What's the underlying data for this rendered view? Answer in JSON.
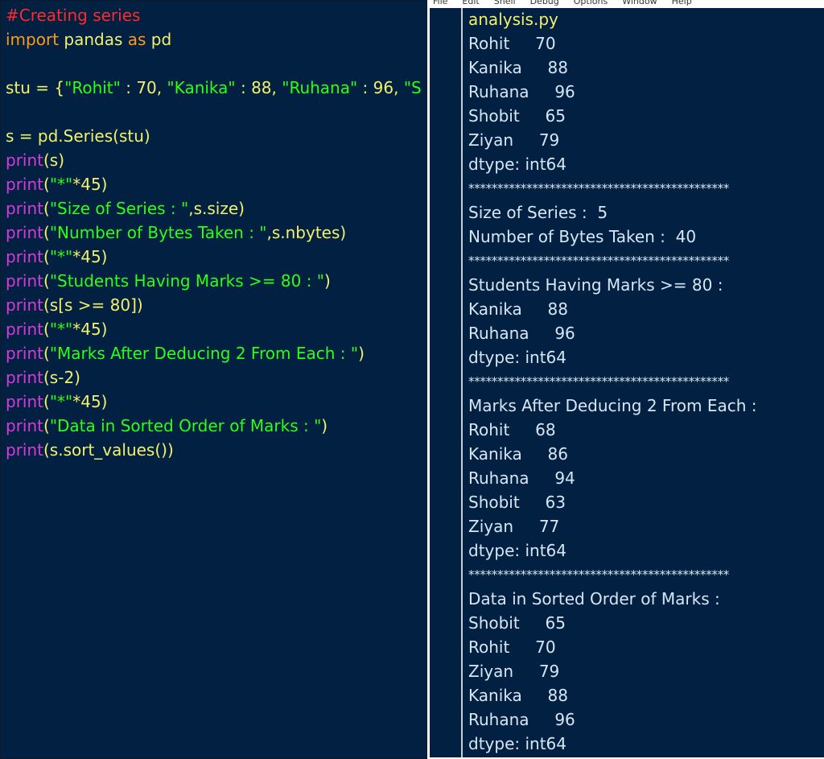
{
  "editor": {
    "lines": [
      {
        "tokens": [
          {
            "t": "comment",
            "v": "#Creating series"
          }
        ]
      },
      {
        "tokens": [
          {
            "t": "keyword",
            "v": "import"
          },
          {
            "t": "plain",
            "v": " pandas "
          },
          {
            "t": "keyword",
            "v": "as"
          },
          {
            "t": "plain",
            "v": " pd"
          }
        ]
      },
      {
        "tokens": []
      },
      {
        "tokens": [
          {
            "t": "plain",
            "v": "stu = {"
          },
          {
            "t": "string",
            "v": "\"Rohit\""
          },
          {
            "t": "plain",
            "v": " : 70, "
          },
          {
            "t": "string",
            "v": "\"Kanika\""
          },
          {
            "t": "plain",
            "v": " : 88, "
          },
          {
            "t": "string",
            "v": "\"Ruhana\""
          },
          {
            "t": "plain",
            "v": " : 96, "
          },
          {
            "t": "string",
            "v": "\"S"
          }
        ]
      },
      {
        "tokens": []
      },
      {
        "tokens": [
          {
            "t": "plain",
            "v": "s = pd.Series(stu)"
          }
        ]
      },
      {
        "tokens": [
          {
            "t": "builtin",
            "v": "print"
          },
          {
            "t": "plain",
            "v": "(s)"
          }
        ]
      },
      {
        "tokens": [
          {
            "t": "builtin",
            "v": "print"
          },
          {
            "t": "plain",
            "v": "("
          },
          {
            "t": "string",
            "v": "\"*\""
          },
          {
            "t": "plain",
            "v": "*45)"
          }
        ]
      },
      {
        "tokens": [
          {
            "t": "builtin",
            "v": "print"
          },
          {
            "t": "plain",
            "v": "("
          },
          {
            "t": "string",
            "v": "\"Size of Series : \""
          },
          {
            "t": "plain",
            "v": ",s.size)"
          }
        ]
      },
      {
        "tokens": [
          {
            "t": "builtin",
            "v": "print"
          },
          {
            "t": "plain",
            "v": "("
          },
          {
            "t": "string",
            "v": "\"Number of Bytes Taken : \""
          },
          {
            "t": "plain",
            "v": ",s.nbytes)"
          }
        ]
      },
      {
        "tokens": [
          {
            "t": "builtin",
            "v": "print"
          },
          {
            "t": "plain",
            "v": "("
          },
          {
            "t": "string",
            "v": "\"*\""
          },
          {
            "t": "plain",
            "v": "*45)"
          }
        ]
      },
      {
        "tokens": [
          {
            "t": "builtin",
            "v": "print"
          },
          {
            "t": "plain",
            "v": "("
          },
          {
            "t": "string",
            "v": "\"Students Having Marks >= 80 : \""
          },
          {
            "t": "plain",
            "v": ")"
          }
        ]
      },
      {
        "tokens": [
          {
            "t": "builtin",
            "v": "print"
          },
          {
            "t": "plain",
            "v": "(s[s >= 80])"
          }
        ]
      },
      {
        "tokens": [
          {
            "t": "builtin",
            "v": "print"
          },
          {
            "t": "plain",
            "v": "("
          },
          {
            "t": "string",
            "v": "\"*\""
          },
          {
            "t": "plain",
            "v": "*45)"
          }
        ]
      },
      {
        "tokens": [
          {
            "t": "builtin",
            "v": "print"
          },
          {
            "t": "plain",
            "v": "("
          },
          {
            "t": "string",
            "v": "\"Marks After Deducing 2 From Each : \""
          },
          {
            "t": "plain",
            "v": ")"
          }
        ]
      },
      {
        "tokens": [
          {
            "t": "builtin",
            "v": "print"
          },
          {
            "t": "plain",
            "v": "(s-2)"
          }
        ]
      },
      {
        "tokens": [
          {
            "t": "builtin",
            "v": "print"
          },
          {
            "t": "plain",
            "v": "("
          },
          {
            "t": "string",
            "v": "\"*\""
          },
          {
            "t": "plain",
            "v": "*45)"
          }
        ]
      },
      {
        "tokens": [
          {
            "t": "builtin",
            "v": "print"
          },
          {
            "t": "plain",
            "v": "("
          },
          {
            "t": "string",
            "v": "\"Data in Sorted Order of Marks : \""
          },
          {
            "t": "plain",
            "v": ")"
          }
        ]
      },
      {
        "tokens": [
          {
            "t": "builtin",
            "v": "print"
          },
          {
            "t": "plain",
            "v": "(s.sort_values())"
          }
        ]
      }
    ]
  },
  "shell": {
    "menu": [
      "File",
      "Edit",
      "Shell",
      "Debug",
      "Options",
      "Window",
      "Help"
    ],
    "lines": [
      {
        "kind": "filename",
        "text": "analysis.py"
      },
      {
        "kind": "out",
        "text": "Rohit     70"
      },
      {
        "kind": "out",
        "text": "Kanika     88"
      },
      {
        "kind": "out",
        "text": "Ruhana     96"
      },
      {
        "kind": "out",
        "text": "Shobit     65"
      },
      {
        "kind": "out",
        "text": "Ziyan     79"
      },
      {
        "kind": "out",
        "text": "dtype: int64"
      },
      {
        "kind": "stars",
        "text": "*********************************************"
      },
      {
        "kind": "out",
        "text": "Size of Series :  5"
      },
      {
        "kind": "out",
        "text": "Number of Bytes Taken :  40"
      },
      {
        "kind": "stars",
        "text": "*********************************************"
      },
      {
        "kind": "out",
        "text": "Students Having Marks >= 80 :"
      },
      {
        "kind": "out",
        "text": "Kanika     88"
      },
      {
        "kind": "out",
        "text": "Ruhana     96"
      },
      {
        "kind": "out",
        "text": "dtype: int64"
      },
      {
        "kind": "stars",
        "text": "*********************************************"
      },
      {
        "kind": "out",
        "text": "Marks After Deducing 2 From Each :"
      },
      {
        "kind": "out",
        "text": "Rohit     68"
      },
      {
        "kind": "out",
        "text": "Kanika     86"
      },
      {
        "kind": "out",
        "text": "Ruhana     94"
      },
      {
        "kind": "out",
        "text": "Shobit     63"
      },
      {
        "kind": "out",
        "text": "Ziyan     77"
      },
      {
        "kind": "out",
        "text": "dtype: int64"
      },
      {
        "kind": "stars",
        "text": "*********************************************"
      },
      {
        "kind": "out",
        "text": "Data in Sorted Order of Marks :"
      },
      {
        "kind": "out",
        "text": "Shobit     65"
      },
      {
        "kind": "out",
        "text": "Rohit     70"
      },
      {
        "kind": "out",
        "text": "Ziyan     79"
      },
      {
        "kind": "out",
        "text": "Kanika     88"
      },
      {
        "kind": "out",
        "text": "Ruhana     96"
      },
      {
        "kind": "out",
        "text": "dtype: int64"
      }
    ]
  },
  "colors": {
    "background": "#022142",
    "comment": "#ff2a2a",
    "keyword": "#ff9a17",
    "builtin": "#d83ad8",
    "string": "#2cff18",
    "plain": "#f3f06b",
    "output": "#d7e6f5"
  }
}
